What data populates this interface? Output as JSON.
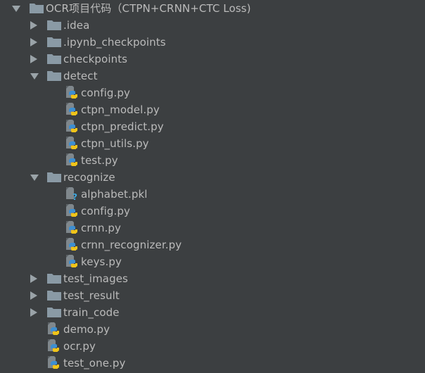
{
  "tree": {
    "root": {
      "label": "OCR项目代码（CTPN+CRNN+CTC Loss)",
      "expanded": true
    },
    "items": [
      {
        "label": ".idea",
        "type": "folder",
        "expanded": false,
        "depth": 1
      },
      {
        "label": ".ipynb_checkpoints",
        "type": "folder",
        "expanded": false,
        "depth": 1
      },
      {
        "label": "checkpoints",
        "type": "folder",
        "expanded": false,
        "depth": 1
      },
      {
        "label": "detect",
        "type": "folder",
        "expanded": true,
        "depth": 1
      },
      {
        "label": "config.py",
        "type": "python",
        "depth": 2
      },
      {
        "label": "ctpn_model.py",
        "type": "python",
        "depth": 2
      },
      {
        "label": "ctpn_predict.py",
        "type": "python",
        "depth": 2
      },
      {
        "label": "ctpn_utils.py",
        "type": "python",
        "depth": 2
      },
      {
        "label": "test.py",
        "type": "python",
        "depth": 2
      },
      {
        "label": "recognize",
        "type": "folder",
        "expanded": true,
        "depth": 1
      },
      {
        "label": "alphabet.pkl",
        "type": "unknown",
        "depth": 2
      },
      {
        "label": "config.py",
        "type": "python",
        "depth": 2
      },
      {
        "label": "crnn.py",
        "type": "python",
        "depth": 2
      },
      {
        "label": "crnn_recognizer.py",
        "type": "python",
        "depth": 2
      },
      {
        "label": "keys.py",
        "type": "python",
        "depth": 2
      },
      {
        "label": "test_images",
        "type": "folder",
        "expanded": false,
        "depth": 1
      },
      {
        "label": "test_result",
        "type": "folder",
        "expanded": false,
        "depth": 1
      },
      {
        "label": "train_code",
        "type": "folder",
        "expanded": false,
        "depth": 1
      },
      {
        "label": "demo.py",
        "type": "python",
        "depth": 1
      },
      {
        "label": "ocr.py",
        "type": "python",
        "depth": 1
      },
      {
        "label": "test_one.py",
        "type": "python",
        "depth": 1
      }
    ]
  },
  "colors": {
    "background": "#3c3f41",
    "text": "#bbbbbb",
    "folder": "#8a9aa5",
    "arrow": "#9aa3a8",
    "python_blue": "#3d8fd1",
    "python_yellow": "#f0c419",
    "unknown_mark": "#3fa9e0"
  }
}
